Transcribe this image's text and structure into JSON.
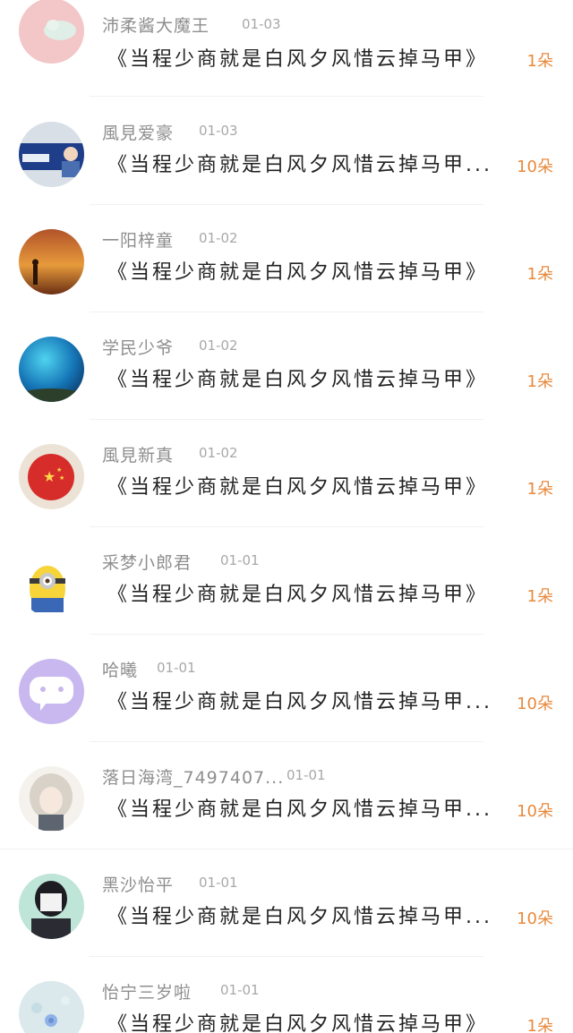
{
  "rows": [
    {
      "name": "沛柔酱大魔王",
      "date": "01-03",
      "title": "《当程少商就是白风夕风惜云掉马甲》",
      "count": "1朵"
    },
    {
      "name": "風見爱豪",
      "date": "01-03",
      "title": "《当程少商就是白风夕风惜云掉马甲...",
      "count": "10朵"
    },
    {
      "name": "一阳梓童",
      "date": "01-02",
      "title": "《当程少商就是白风夕风惜云掉马甲》",
      "count": "1朵"
    },
    {
      "name": "学民少爷",
      "date": "01-02",
      "title": "《当程少商就是白风夕风惜云掉马甲》",
      "count": "1朵"
    },
    {
      "name": "風見新真",
      "date": "01-02",
      "title": "《当程少商就是白风夕风惜云掉马甲》",
      "count": "1朵"
    },
    {
      "name": "采梦小郎君",
      "date": "01-01",
      "title": "《当程少商就是白风夕风惜云掉马甲》",
      "count": "1朵"
    },
    {
      "name": "哈曦",
      "date": "01-01",
      "title": "《当程少商就是白风夕风惜云掉马甲...",
      "count": "10朵"
    },
    {
      "name": "落日海湾_7497407...",
      "date": "01-01",
      "title": "《当程少商就是白风夕风惜云掉马甲...",
      "count": "10朵"
    },
    {
      "name": "黑沙怡平",
      "date": "01-01",
      "title": "《当程少商就是白风夕风惜云掉马甲...",
      "count": "10朵"
    },
    {
      "name": "怡宁三岁啦",
      "date": "01-01",
      "title": "《当程少商就是白风夕风惜云掉马甲》",
      "count": "1朵"
    }
  ]
}
